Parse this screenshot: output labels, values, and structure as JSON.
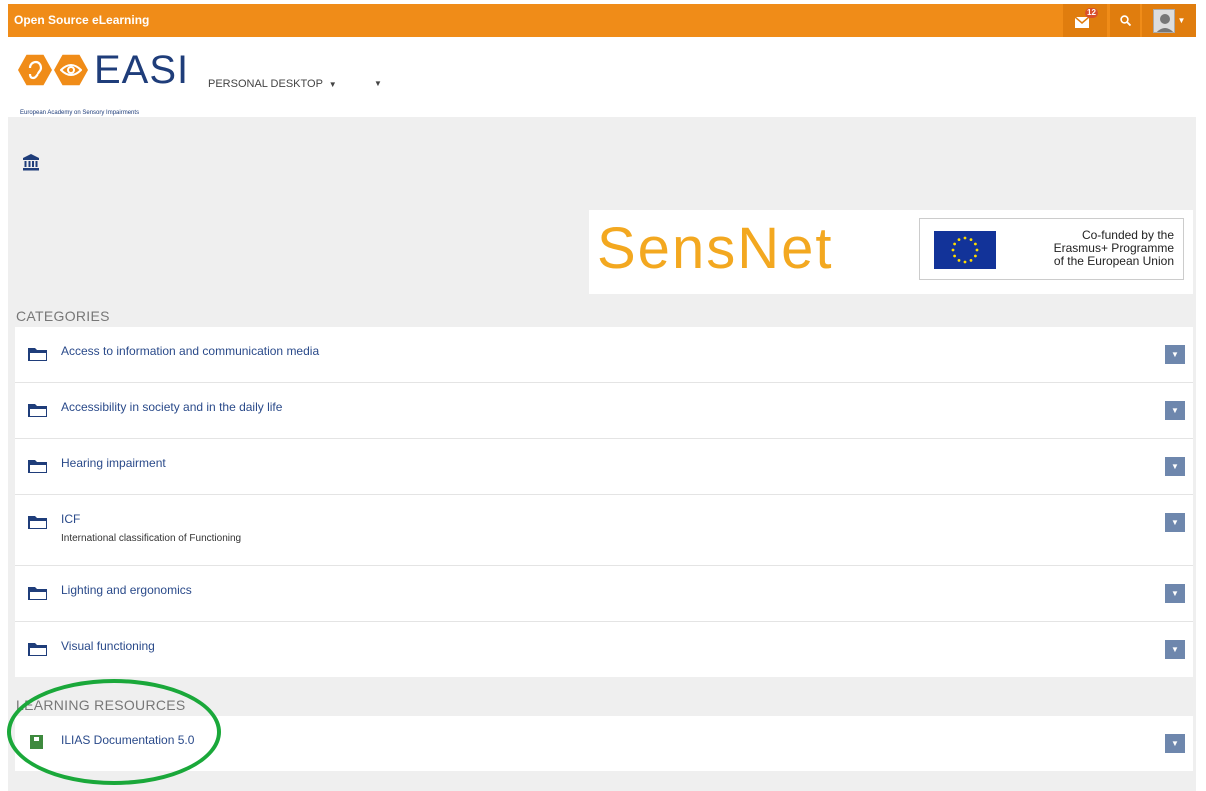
{
  "topbar": {
    "brand": "Open Source eLearning",
    "mail_count": "12",
    "icons": [
      "mail-icon",
      "search-icon",
      "user-avatar-icon"
    ],
    "color": "#f08c18"
  },
  "header": {
    "logo_text": "EASI",
    "logo_subtitle": "European Academy on Sensory Impairments",
    "nav_personal": "PERSONAL DESKTOP"
  },
  "banner": {
    "sensnet": "SensNet",
    "eu_line1": "Co-funded by the",
    "eu_line2": "Erasmus+ Programme",
    "eu_line3": "of the European Union"
  },
  "categories": {
    "title": "CATEGORIES",
    "items": [
      {
        "label": "Access to information and communication media",
        "desc": ""
      },
      {
        "label": "Accessibility in society and in the daily life",
        "desc": ""
      },
      {
        "label": "Hearing impairment",
        "desc": ""
      },
      {
        "label": "ICF",
        "desc": "International classification of Functioning"
      },
      {
        "label": "Lighting and ergonomics",
        "desc": ""
      },
      {
        "label": "Visual functioning",
        "desc": ""
      }
    ]
  },
  "learning_resources": {
    "title": "LEARNING RESOURCES",
    "items": [
      {
        "label": "ILIAS Documentation 5.0"
      }
    ]
  },
  "colors": {
    "accent": "#f08c18",
    "link": "#2a4a8a",
    "action_button": "#6e87ad",
    "highlight_ellipse": "#1aa83a"
  }
}
